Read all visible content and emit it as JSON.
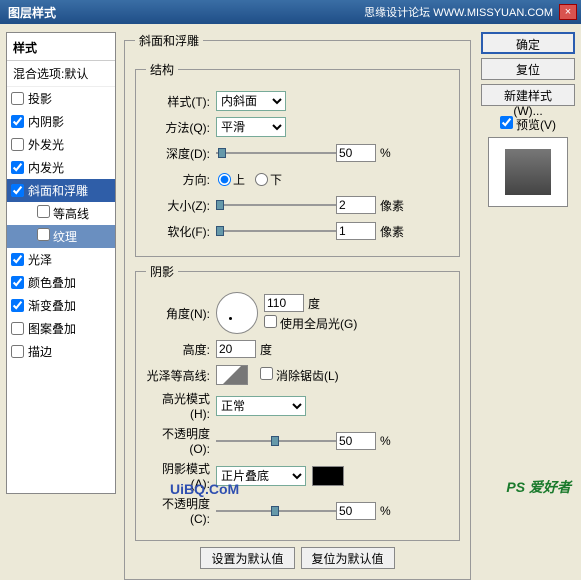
{
  "title": "图层样式",
  "title_extra": "思缘设计论坛  WWW.MISSYUAN.COM",
  "close": "×",
  "left": {
    "header": "样式",
    "blend": "混合选项:默认",
    "items": [
      {
        "label": "投影",
        "checked": false
      },
      {
        "label": "内阴影",
        "checked": true
      },
      {
        "label": "外发光",
        "checked": false
      },
      {
        "label": "内发光",
        "checked": true
      },
      {
        "label": "斜面和浮雕",
        "checked": true,
        "active": true
      },
      {
        "label": "光泽",
        "checked": true
      },
      {
        "label": "颜色叠加",
        "checked": true
      },
      {
        "label": "渐变叠加",
        "checked": true
      },
      {
        "label": "图案叠加",
        "checked": false
      },
      {
        "label": "描边",
        "checked": false
      }
    ],
    "children": [
      {
        "label": "等高线",
        "sel": false
      },
      {
        "label": "纹理",
        "sel": true
      }
    ]
  },
  "mid": {
    "group1": "斜面和浮雕",
    "group_struct": "结构",
    "style_lbl": "样式(T):",
    "style_val": "内斜面",
    "method_lbl": "方法(Q):",
    "method_val": "平滑",
    "depth_lbl": "深度(D):",
    "depth_val": "50",
    "pct": "%",
    "dir_lbl": "方向:",
    "up": "上",
    "down": "下",
    "size_lbl": "大小(Z):",
    "size_val": "2",
    "px": "像素",
    "soft_lbl": "软化(F):",
    "soft_val": "1",
    "group_shadow": "阴影",
    "angle_lbl": "角度(N):",
    "angle_val": "110",
    "deg": "度",
    "global": "使用全局光(G)",
    "alt_lbl": "高度:",
    "alt_val": "20",
    "gloss_lbl": "光泽等高线:",
    "antialias": "消除锯齿(L)",
    "hilite_lbl": "高光模式(H):",
    "hilite_val": "正常",
    "opac_lbl": "不透明度(O):",
    "opac_val": "50",
    "shadmode_lbl": "阴影模式(A):",
    "shadmode_val": "正片叠底",
    "opac2_lbl": "不透明度(C):",
    "opac2_val": "50",
    "setdef": "设置为默认值",
    "resetdef": "复位为默认值"
  },
  "right": {
    "ok": "确定",
    "reset": "复位",
    "newstyle": "新建样式(W)...",
    "preview": "预览(V)"
  },
  "wm1": "PS 爱好者",
  "wm2": "UiBQ.CoM"
}
